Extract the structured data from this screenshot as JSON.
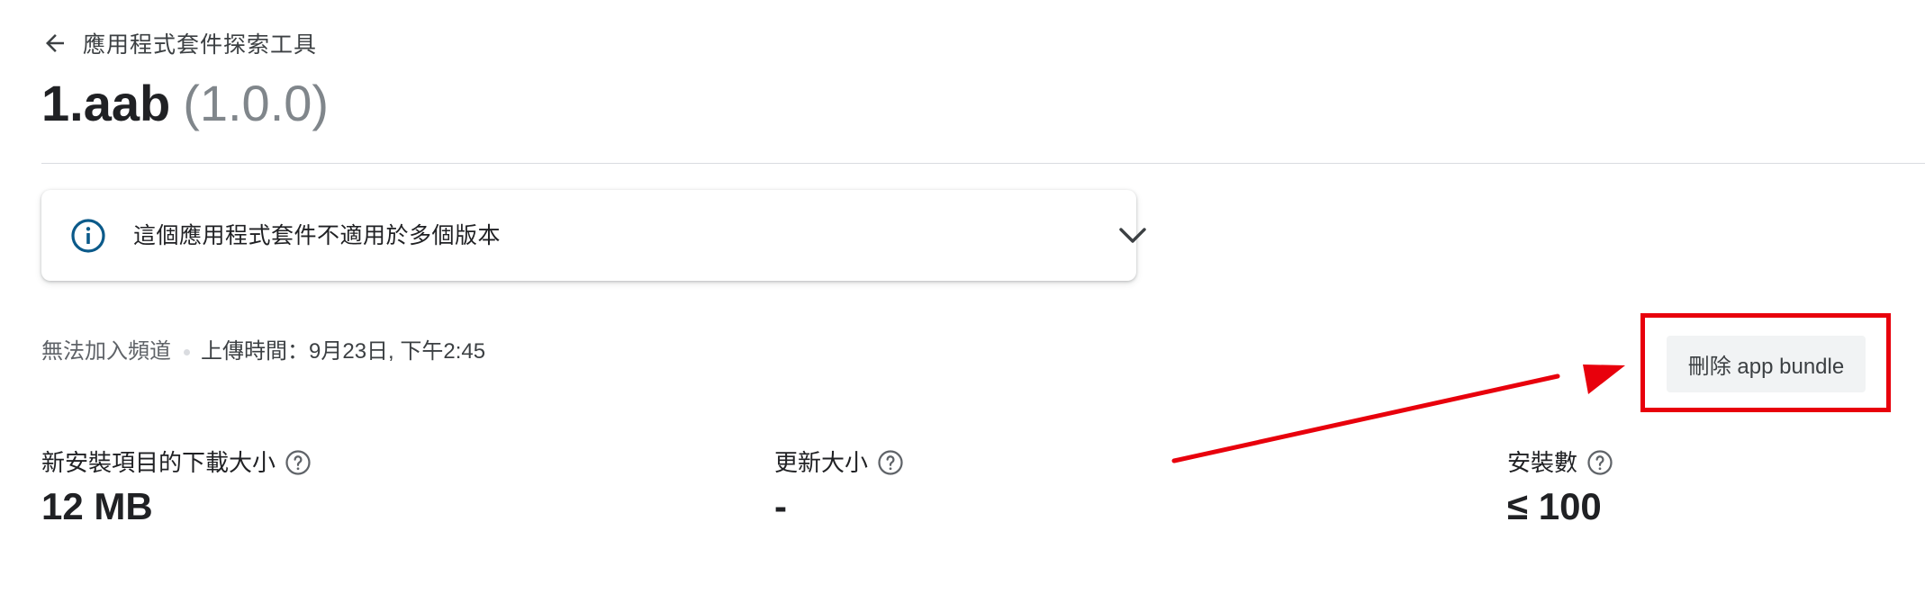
{
  "nav": {
    "back_label": "應用程式套件探索工具"
  },
  "header": {
    "name": "1.aab",
    "version": "(1.0.0)"
  },
  "info_card": {
    "message": "這個應用程式套件不適用於多個版本",
    "icon": "info-icon",
    "expand_icon": "chevron-down-icon"
  },
  "meta": {
    "channel_status": "無法加入頻道",
    "upload_time": "上傳時間：9月23日, 下午2:45"
  },
  "actions": {
    "delete_label": "刪除 app bundle"
  },
  "annotation": {
    "highlight_color": "#e8000c",
    "arrow_color": "#e8000c"
  },
  "stats": [
    {
      "label": "新安裝項目的下載大小",
      "value": "12 MB"
    },
    {
      "label": "更新大小",
      "value": "-"
    },
    {
      "label": "安裝數",
      "value": "≤ 100"
    }
  ],
  "colors": {
    "info_icon": "#0b5a8a",
    "text_primary": "#202124",
    "text_secondary": "#5f6368"
  }
}
